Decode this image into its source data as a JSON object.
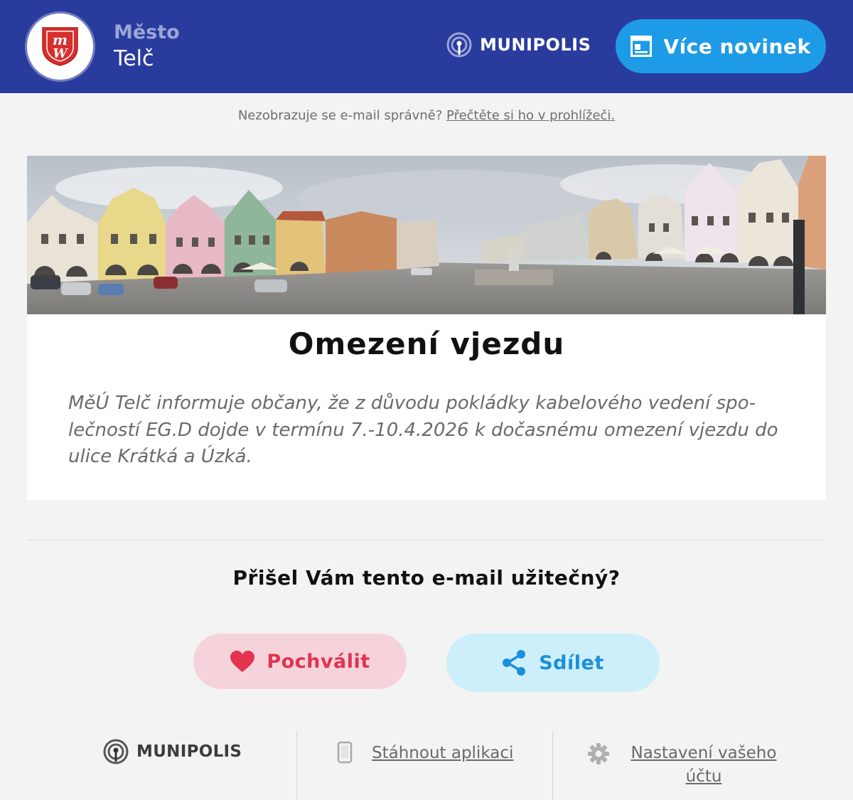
{
  "header": {
    "city_label": "Město",
    "city_name": "Telč",
    "brand": "MUNIPOLIS",
    "more_news_label": "Více novinek",
    "colors": {
      "background": "#2a3b9e",
      "button": "#1e9be6"
    }
  },
  "notice": {
    "text": "Nezobrazuje se e-mail správně?",
    "link": "Přečtěte si ho v prohlížeči."
  },
  "article": {
    "banner_image": "Telč town square panorama with colorful gabled houses",
    "title": "Omezení vjezdu",
    "body": "MěÚ Telč informuje občany, že z důvodu pokládky kabelového vedení spo-lečností EG.D dojde v termínu 7.-10.4.2026 k dočasnému omezení vjezdu do ulice Krátká a Úzká."
  },
  "feedback": {
    "question": "Přišel Vám tento e-mail užitečný?",
    "praise_label": "Pochválit",
    "share_label": "Sdílet",
    "colors": {
      "praise": "#e2334f",
      "share": "#1b8fd8"
    }
  },
  "footer": {
    "brand": "MUNIPOLIS",
    "download_label": "Stáhnout aplikaci",
    "settings_line1": "Nastavení vašeho",
    "settings_line2": "účtu",
    "icons": [
      "munipolis-icon",
      "phone-icon",
      "gear-icon"
    ]
  }
}
